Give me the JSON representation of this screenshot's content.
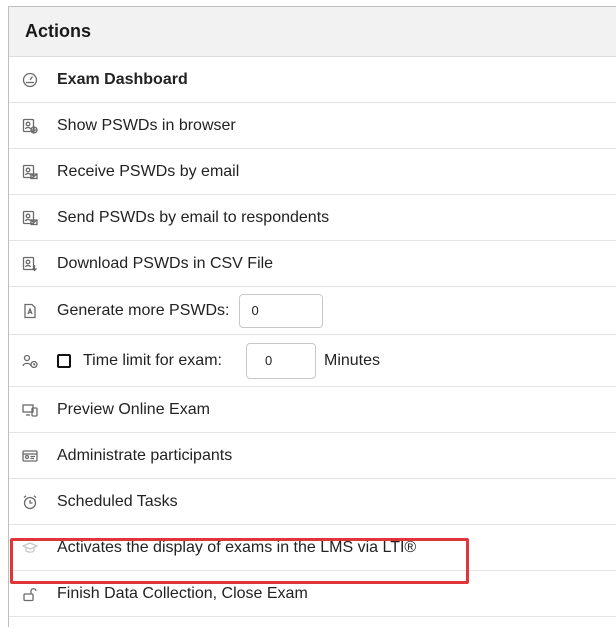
{
  "header": {
    "title": "Actions"
  },
  "items": [
    {
      "label": "Exam Dashboard",
      "icon": "dashboard-icon"
    },
    {
      "label": "Show PSWDs in browser",
      "icon": "password-browser-icon"
    },
    {
      "label": "Receive PSWDs by email",
      "icon": "password-email-icon"
    },
    {
      "label": "Send PSWDs by email to respondents",
      "icon": "password-send-icon"
    },
    {
      "label": "Download PSWDs in CSV File",
      "icon": "password-download-icon"
    },
    {
      "label": "Generate more PSWDs:",
      "icon": "document-icon",
      "input_value": "0"
    },
    {
      "label": "Time limit for exam:",
      "icon": "users-clock-icon",
      "input_value": "0",
      "unit": "Minutes"
    },
    {
      "label": "Preview Online Exam",
      "icon": "preview-icon"
    },
    {
      "label": "Administrate participants",
      "icon": "id-card-icon"
    },
    {
      "label": "Scheduled Tasks",
      "icon": "alarm-clock-icon"
    },
    {
      "label": "Activates the display of exams in the LMS via LTI®",
      "icon": "graduation-cap-icon",
      "highlighted": true
    },
    {
      "label": "Finish Data Collection, Close Exam",
      "icon": "unlock-icon"
    }
  ],
  "colors": {
    "highlight_border": "#e0353b",
    "header_bg": "#f2f2f2"
  }
}
